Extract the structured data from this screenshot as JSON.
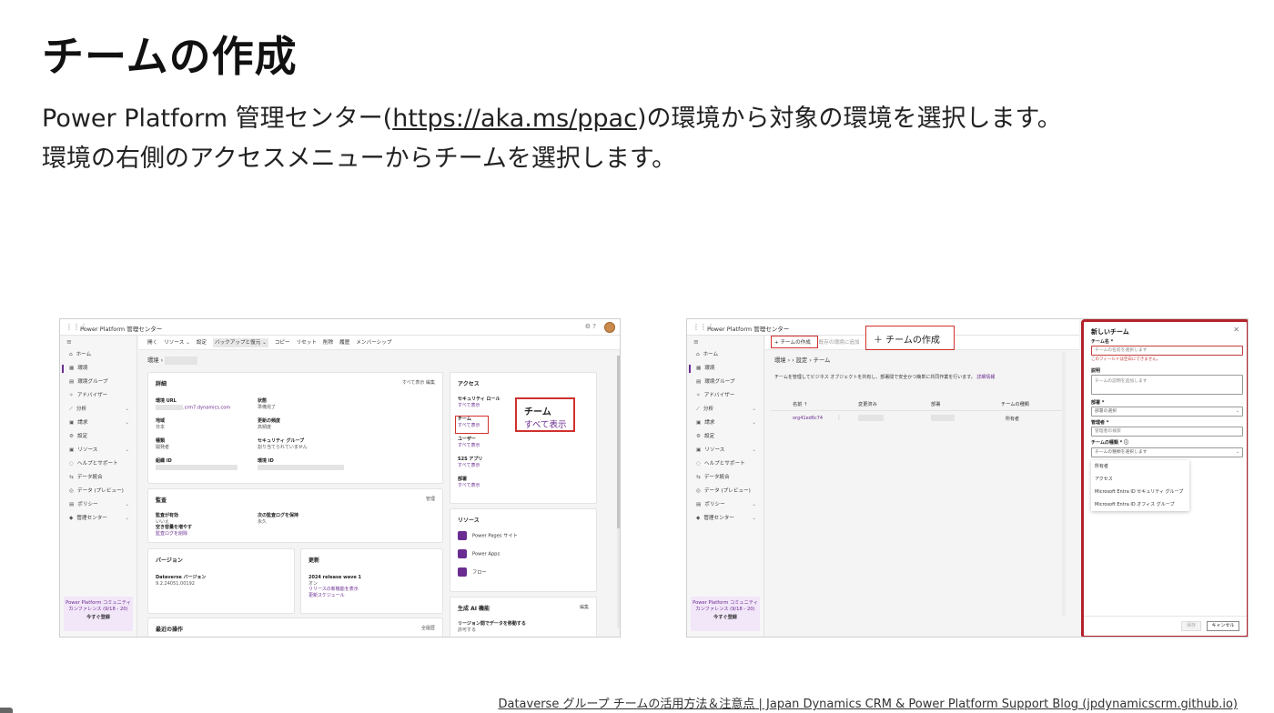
{
  "slide": {
    "title": "チームの作成",
    "line1_before": "Power Platform 管理センター(",
    "line1_link": "https://aka.ms/ppac",
    "line1_after": ")の環境から対象の環境を選択します。",
    "line2": "環境の右側のアクセスメニューからチームを選択します。",
    "footer_link": "Dataverse グループ チームの活用方法＆注意点 | Japan Dynamics CRM & Power Platform Support Blog (jpdynamicscrm.github.io)"
  },
  "left_shot": {
    "app_title": "Power Platform 管理センター",
    "topbar_icons": "⚙  ?",
    "sidebar": [
      {
        "label": "ホーム",
        "icon": "⌂",
        "chev": false,
        "active": false
      },
      {
        "label": "環境",
        "icon": "▦",
        "chev": false,
        "active": true
      },
      {
        "label": "環境グループ",
        "icon": "▤",
        "chev": false,
        "active": false
      },
      {
        "label": "アドバイザー",
        "icon": "✧",
        "chev": false,
        "active": false
      },
      {
        "label": "分析",
        "icon": "⟋",
        "chev": true,
        "active": false
      },
      {
        "label": "請求",
        "icon": "▣",
        "chev": true,
        "active": false
      },
      {
        "label": "設定",
        "icon": "⚙",
        "chev": false,
        "active": false
      },
      {
        "label": "リソース",
        "icon": "▣",
        "chev": true,
        "active": false
      },
      {
        "label": "ヘルプとサポート",
        "icon": "◌",
        "chev": false,
        "active": false
      },
      {
        "label": "データ統合",
        "icon": "⇆",
        "chev": false,
        "active": false
      },
      {
        "label": "データ (プレビュー)",
        "icon": "◎",
        "chev": false,
        "active": false
      },
      {
        "label": "ポリシー",
        "icon": "▤",
        "chev": true,
        "active": false
      },
      {
        "label": "管理センター",
        "icon": "◆",
        "chev": true,
        "active": false
      }
    ],
    "promo_text": "Power Platform コミュニティ カンファレンス (9/18 - 20)",
    "promo_button": "今すぐ登録",
    "cmdbar": [
      "開く",
      "リソース ⌄",
      "設定",
      "バックアップと復元 ⌄",
      "コピー",
      "リセット",
      "削除",
      "履歴",
      "メンバーシップ"
    ],
    "breadcrumb": "環境 ›",
    "details": {
      "title": "詳細",
      "links": "すべて表示   編集",
      "url_label": "環境 URL",
      "url_value": ".crm7.dynamics.com",
      "state_label": "状態",
      "state_value": "準備完了",
      "region_label": "地域",
      "region_value": "日本",
      "update_label": "更新の頻度",
      "update_value": "高頻度",
      "type_label": "種類",
      "type_value": "開発者",
      "secgroup_label": "セキュリティ グループ",
      "secgroup_value": "割り当てられていません",
      "org_label": "組織 ID",
      "env_label": "環境 ID"
    },
    "audit": {
      "title": "監査",
      "link": "管理",
      "enabled_label": "監査が有効",
      "enabled_value": "いいえ",
      "log_label": "次の監査ログを保持",
      "log_value": "永久",
      "space_label": "空き容量を増やす",
      "space_link": "監査ログを削除"
    },
    "version": {
      "title": "バージョン",
      "dv_label": "Dataverse バージョン",
      "dv_value": "9.2.24051.00192"
    },
    "updates": {
      "title": "更新",
      "wave_label": "2024 release wave 1",
      "wave_value": "オン",
      "link1": "リリースの新機能を表示",
      "link2": "更新スケジュール"
    },
    "recent": {
      "title": "最近の操作",
      "link": "全履歴"
    },
    "access": {
      "title": "アクセス",
      "items": [
        {
          "label": "セキュリティ ロール",
          "link": "すべて表示"
        },
        {
          "label": "チーム",
          "link": "すべて表示"
        },
        {
          "label": "ユーザー",
          "link": "すべて表示"
        },
        {
          "label": "S2S アプリ",
          "link": "すべて表示"
        },
        {
          "label": "部署",
          "link": "すべて表示"
        }
      ]
    },
    "resources": {
      "title": "リソース",
      "items": [
        "Power Pages サイト",
        "Power Apps",
        "フロー"
      ]
    },
    "genai": {
      "title": "生成 AI 機能",
      "link": "編集",
      "row_label": "リージョン間でデータを移動する",
      "row_value": "許可する"
    },
    "callout": {
      "title": "チーム",
      "link": "すべて表示"
    }
  },
  "right_shot": {
    "app_title": "Power Platform 管理センター",
    "sidebar": [
      {
        "label": "ホーム",
        "icon": "⌂",
        "chev": false,
        "active": false
      },
      {
        "label": "環境",
        "icon": "▦",
        "chev": false,
        "active": true
      },
      {
        "label": "環境グループ",
        "icon": "▤",
        "chev": false,
        "active": false
      },
      {
        "label": "アドバイザー",
        "icon": "✧",
        "chev": false,
        "active": false
      },
      {
        "label": "分析",
        "icon": "⟋",
        "chev": true,
        "active": false
      },
      {
        "label": "請求",
        "icon": "▣",
        "chev": true,
        "active": false
      },
      {
        "label": "設定",
        "icon": "⚙",
        "chev": false,
        "active": false
      },
      {
        "label": "リソース",
        "icon": "▣",
        "chev": true,
        "active": false
      },
      {
        "label": "ヘルプとサポート",
        "icon": "◌",
        "chev": false,
        "active": false
      },
      {
        "label": "データ統合",
        "icon": "⇆",
        "chev": false,
        "active": false
      },
      {
        "label": "データ (プレビュー)",
        "icon": "◎",
        "chev": false,
        "active": false
      },
      {
        "label": "ポリシー",
        "icon": "▤",
        "chev": true,
        "active": false
      },
      {
        "label": "管理センター",
        "icon": "◆",
        "chev": true,
        "active": false
      }
    ],
    "promo_text": "Power Platform コミュニティ カンファレンス (9/18 - 20)",
    "promo_button": "今すぐ登録",
    "cmd_create": "+ チームの作成",
    "cmd_other": "既存の環境に追加",
    "callout_create": "＋ チームの作成",
    "breadcrumb": "環境 ›             › 設定 › チーム",
    "description": "チームを管理してビジネス オブジェクトを共有し、部署間で安全かつ簡単に共同作業を行います。",
    "description_link": "詳細情報",
    "table_headers": [
      "名前 ↑",
      "変更済み",
      "部署",
      "チームの種類"
    ],
    "table_row": {
      "name": "org41ed6c74",
      "type": "所有者"
    },
    "panel": {
      "title": "新しいチーム",
      "close": "✕",
      "name_label": "チーム名 *",
      "name_placeholder": "チームの名前を選択します",
      "name_error": "このフィールドは空白にできません。",
      "desc_label": "説明",
      "desc_placeholder": "チームの説明を追加します",
      "bu_label": "部署 *",
      "bu_value": "部署の選択",
      "admin_label": "管理者 *",
      "admin_placeholder": "管理者の検索",
      "type_label": "チームの種類 *  ⓘ",
      "type_placeholder": "チームの種類を選択します",
      "options": [
        "所有者",
        "アクセス",
        "Microsoft Entra ID セキュリティ グループ",
        "Microsoft Entra ID オフィス グループ"
      ],
      "save": "保存",
      "cancel": "キャンセル"
    }
  }
}
